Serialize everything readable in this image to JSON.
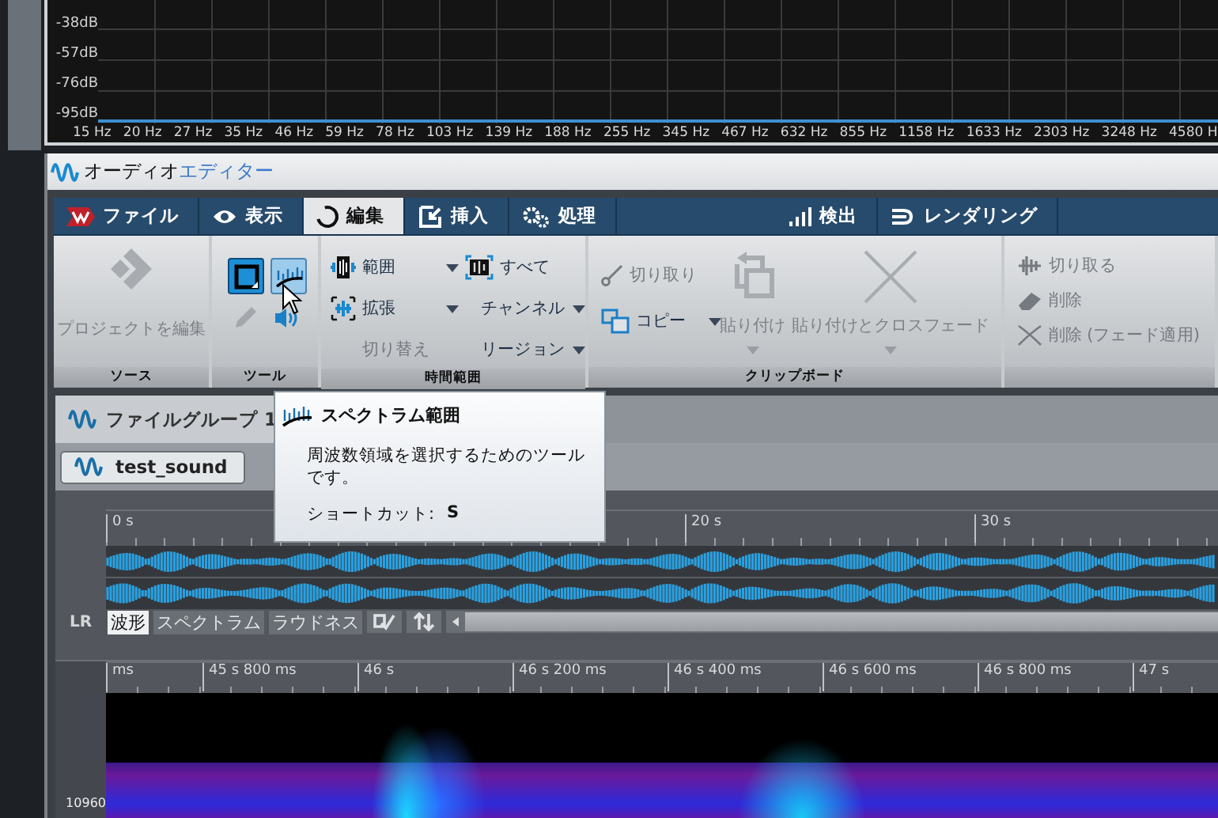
{
  "spectrum": {
    "y_labels": [
      "-38dB",
      "-57dB",
      "-76dB",
      "-95dB"
    ],
    "x_labels": [
      "15 Hz",
      "20 Hz",
      "27 Hz",
      "35 Hz",
      "46 Hz",
      "59 Hz",
      "78 Hz",
      "103 Hz",
      "139 Hz",
      "188 Hz",
      "255 Hz",
      "345 Hz",
      "467 Hz",
      "632 Hz",
      "855 Hz",
      "1158 Hz",
      "1633 Hz",
      "2303 Hz",
      "3248 Hz",
      "4580 H"
    ]
  },
  "editor": {
    "title": "オーディオ",
    "title_accent": "エディター",
    "tabs": [
      {
        "label": "ファイル",
        "selected": false
      },
      {
        "label": "表示",
        "selected": false
      },
      {
        "label": "編集",
        "selected": true
      },
      {
        "label": "挿入",
        "selected": false
      },
      {
        "label": "処理",
        "selected": false
      }
    ],
    "right_tabs": [
      {
        "label": "検出",
        "selected": false
      },
      {
        "label": "レンダリング",
        "selected": false
      }
    ],
    "source": {
      "label": "ソース",
      "items": [
        {
          "label": "プロジェクトを編集",
          "disabled": true
        }
      ]
    },
    "tools": {
      "label": "ツール",
      "buttons": [
        {
          "selected": true,
          "hovered": false
        },
        {
          "selected": false,
          "hovered": true
        }
      ],
      "small": [
        {
          "disabled": true
        },
        {
          "disabled": false
        }
      ]
    },
    "time_range": {
      "label": "時間範囲",
      "items": [
        {
          "label": "範囲",
          "disabled": false
        },
        {
          "label": "拡張",
          "disabled": false
        },
        {
          "label": "切り替え",
          "disabled": true
        },
        {
          "label": "すべて",
          "disabled": false
        },
        {
          "label": "チャンネル",
          "disabled": false
        },
        {
          "label": "リージョン",
          "disabled": false
        }
      ]
    },
    "clipboard": {
      "label": "クリップボード",
      "items": [
        {
          "label": "切り取り",
          "disabled": true
        },
        {
          "label": "コピー",
          "disabled": false
        },
        {
          "label": "貼り付け",
          "disabled": true
        },
        {
          "label": "貼り付けとクロスフェード",
          "disabled": true
        }
      ]
    },
    "trim": {
      "items": [
        {
          "label": "切り取る",
          "disabled": true
        },
        {
          "label": "削除",
          "disabled": true
        },
        {
          "label": "削除 (フェード適用)",
          "disabled": true
        }
      ]
    }
  },
  "file_group_tab": {
    "label": "ファイルグループ 1",
    "selected": true
  },
  "file_tab": {
    "label": "test_sound",
    "selected": true
  },
  "waveform": {
    "ruler": [
      "0 s",
      "20 s",
      "30 s"
    ],
    "channel_label": "LR",
    "view_tabs": [
      {
        "label": "波形",
        "selected": true
      },
      {
        "label": "スペクトラム",
        "selected": false
      },
      {
        "label": "ラウドネス",
        "selected": false
      }
    ]
  },
  "spectrogram": {
    "ruler": [
      "ms",
      "45 s 800 ms",
      "46 s",
      "46 s 200 ms",
      "46 s 400 ms",
      "46 s 600 ms",
      "46 s 800 ms",
      "47 s"
    ],
    "freq_label": "10960"
  },
  "tooltip": {
    "title": "スペクトラム範囲",
    "text": "周波数領域を選択するためのツールです。",
    "shortcut_label": "ショートカット:",
    "shortcut_key": "S"
  }
}
